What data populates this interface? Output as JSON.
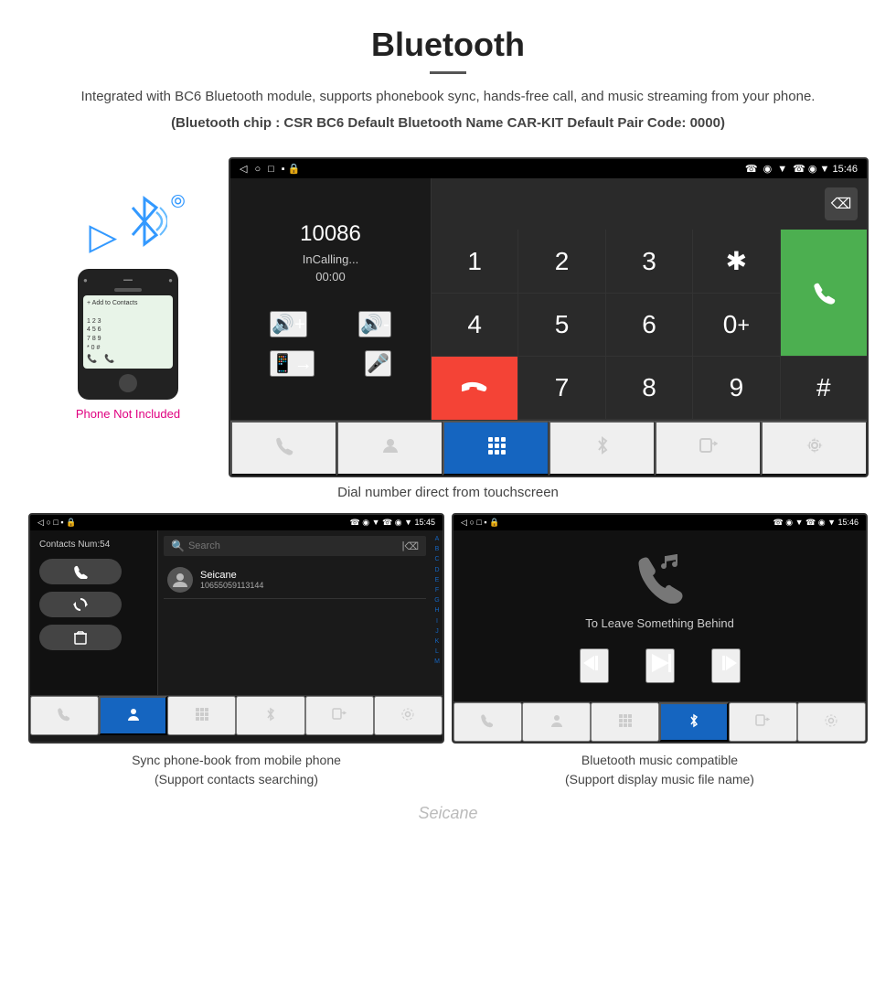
{
  "header": {
    "title": "Bluetooth",
    "description": "Integrated with BC6 Bluetooth module, supports phonebook sync, hands-free call, and music streaming from your phone.",
    "specs_line": "(Bluetooth chip : CSR BC6    Default Bluetooth Name CAR-KIT    Default Pair Code: 0000)"
  },
  "dial_screen": {
    "status_bar": {
      "left": [
        "◁",
        "○",
        "□",
        "▪ 🔒"
      ],
      "right": "☎ ◉ ▼ 15:46"
    },
    "dial_number": "10086",
    "call_status": "InCalling...",
    "timer": "00:00",
    "keys": [
      "1",
      "2",
      "3",
      "*",
      "4",
      "5",
      "6",
      "0+",
      "7",
      "8",
      "9",
      "#"
    ],
    "call_btn": "📞",
    "end_btn": "📵",
    "nav_items": [
      "📲",
      "👤",
      "⊞",
      "✳",
      "📱",
      "⚙"
    ]
  },
  "caption_dial": "Dial number direct from touchscreen",
  "contacts_screen": {
    "status_bar_right": "☎ ◉ ▼ 15:45",
    "contacts_num": "Contacts Num:54",
    "search_placeholder": "Search",
    "contact": {
      "name": "Seicane",
      "number": "10655059113144"
    },
    "alpha_letters": [
      "A",
      "B",
      "C",
      "D",
      "E",
      "F",
      "G",
      "H",
      "I",
      "J",
      "K",
      "L",
      "M"
    ]
  },
  "music_screen": {
    "status_bar_right": "☎ ◉ ▼ 15:46",
    "song_title": "To Leave Something Behind"
  },
  "caption_contacts": "Sync phone-book from mobile phone\n(Support contacts searching)",
  "caption_music": "Bluetooth music compatible\n(Support display music file name)",
  "watermark": "Seicane",
  "phone_aside": {
    "not_included": "Phone Not Included"
  }
}
